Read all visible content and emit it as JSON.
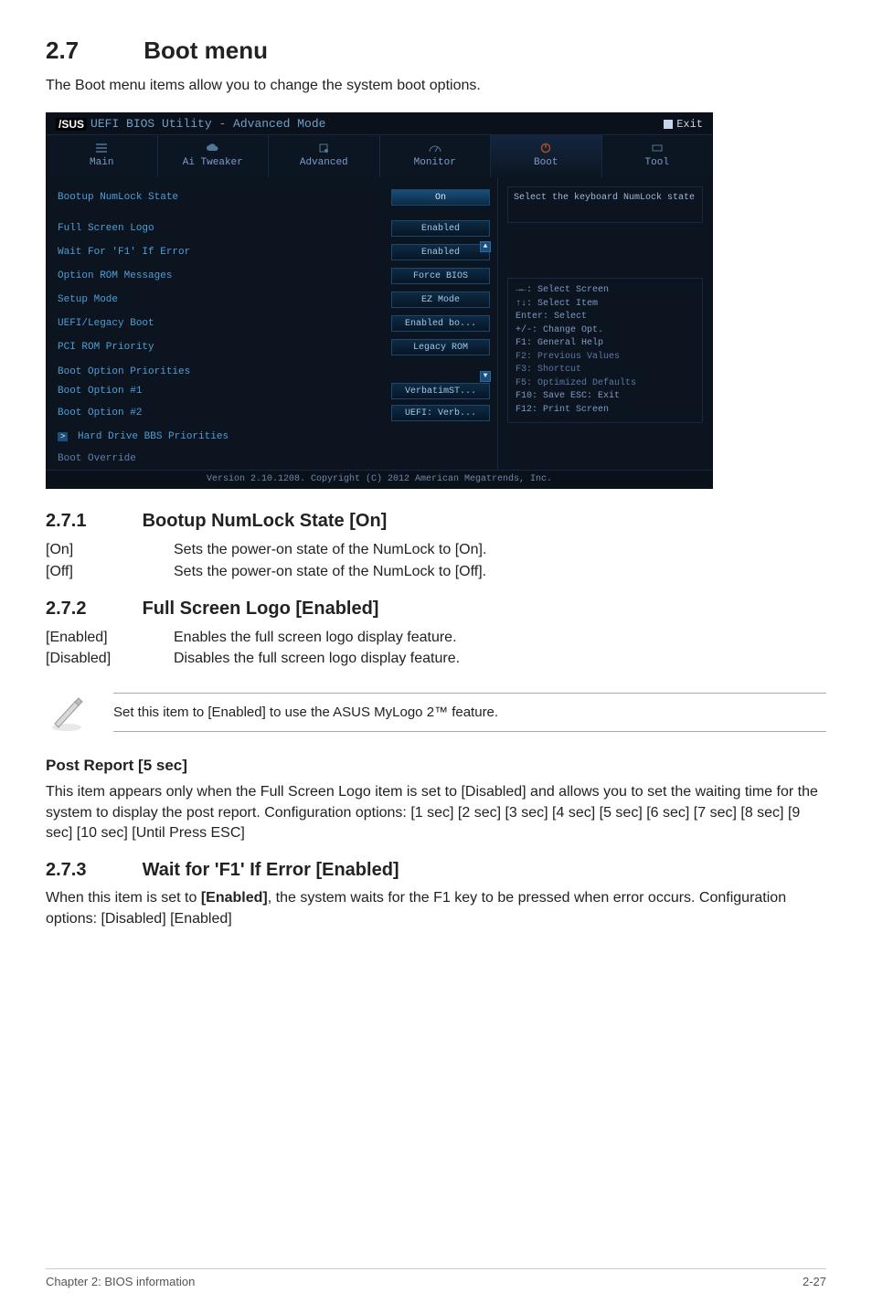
{
  "heading": {
    "num": "2.7",
    "title": "Boot menu"
  },
  "intro": "The Boot menu items allow you to change the system boot options.",
  "bios": {
    "titlebar": {
      "brand": "/SUS",
      "title": "UEFI BIOS Utility - Advanced Mode",
      "exit": "Exit"
    },
    "tabs": [
      "Main",
      "Ai Tweaker",
      "Advanced",
      "Monitor",
      "Boot",
      "Tool"
    ],
    "rows": [
      {
        "label": "Bootup NumLock State",
        "value": "On",
        "highlight": true
      },
      {
        "label": "Full Screen Logo",
        "value": "Enabled"
      },
      {
        "label": "Wait For 'F1' If Error",
        "value": "Enabled"
      },
      {
        "label": "Option ROM Messages",
        "value": "Force BIOS"
      },
      {
        "label": "Setup Mode",
        "value": "EZ Mode"
      },
      {
        "label": "UEFI/Legacy Boot",
        "value": "Enabled bo..."
      },
      {
        "label": "PCI ROM Priority",
        "value": "Legacy ROM"
      }
    ],
    "priorities_header": "Boot Option Priorities",
    "priorities": [
      {
        "label": "Boot Option #1",
        "value": "VerbatimST..."
      },
      {
        "label": "Boot Option #2",
        "value": "UEFI: Verb..."
      }
    ],
    "submenu": "Hard Drive BBS Priorities",
    "override": "Boot Override",
    "help": "Select the keyboard NumLock state",
    "keys": [
      "→←: Select Screen",
      "↑↓: Select Item",
      "Enter: Select",
      "+/-: Change Opt.",
      "F1: General Help",
      "F2: Previous Values",
      "F3: Shortcut",
      "F5: Optimized Defaults",
      "F10: Save   ESC: Exit",
      "F12: Print Screen"
    ],
    "footer": "Version 2.10.1208. Copyright (C) 2012 American Megatrends, Inc."
  },
  "s271": {
    "num": "2.7.1",
    "title": "Bootup NumLock State [On]",
    "opts": [
      {
        "k": "[On]",
        "v": "Sets the power-on state of the NumLock to [On]."
      },
      {
        "k": "[Off]",
        "v": "Sets the power-on state of the NumLock to [Off]."
      }
    ]
  },
  "s272": {
    "num": "2.7.2",
    "title": "Full Screen Logo [Enabled]",
    "opts": [
      {
        "k": "[Enabled]",
        "v": "Enables the full screen logo display feature."
      },
      {
        "k": "[Disabled]",
        "v": "Disables the full screen logo display feature."
      }
    ]
  },
  "note": "Set this item to [Enabled] to use the ASUS MyLogo 2™ feature.",
  "post": {
    "title": "Post Report [5 sec]",
    "body": "This item appears only when the Full Screen Logo item is set to [Disabled] and allows you to set the waiting time for the system to display the post report. Configuration options: [1 sec] [2 sec] [3 sec] [4 sec] [5 sec] [6 sec] [7 sec] [8 sec] [9 sec] [10 sec] [Until Press ESC]"
  },
  "s273": {
    "num": "2.7.3",
    "title": "Wait for 'F1' If Error [Enabled]",
    "body_pre": "When this item is set to ",
    "body_bold": "[Enabled]",
    "body_post": ", the system waits for the F1 key to be pressed when error occurs. Configuration options: [Disabled] [Enabled]"
  },
  "footer": {
    "left": "Chapter 2: BIOS information",
    "right": "2-27"
  }
}
